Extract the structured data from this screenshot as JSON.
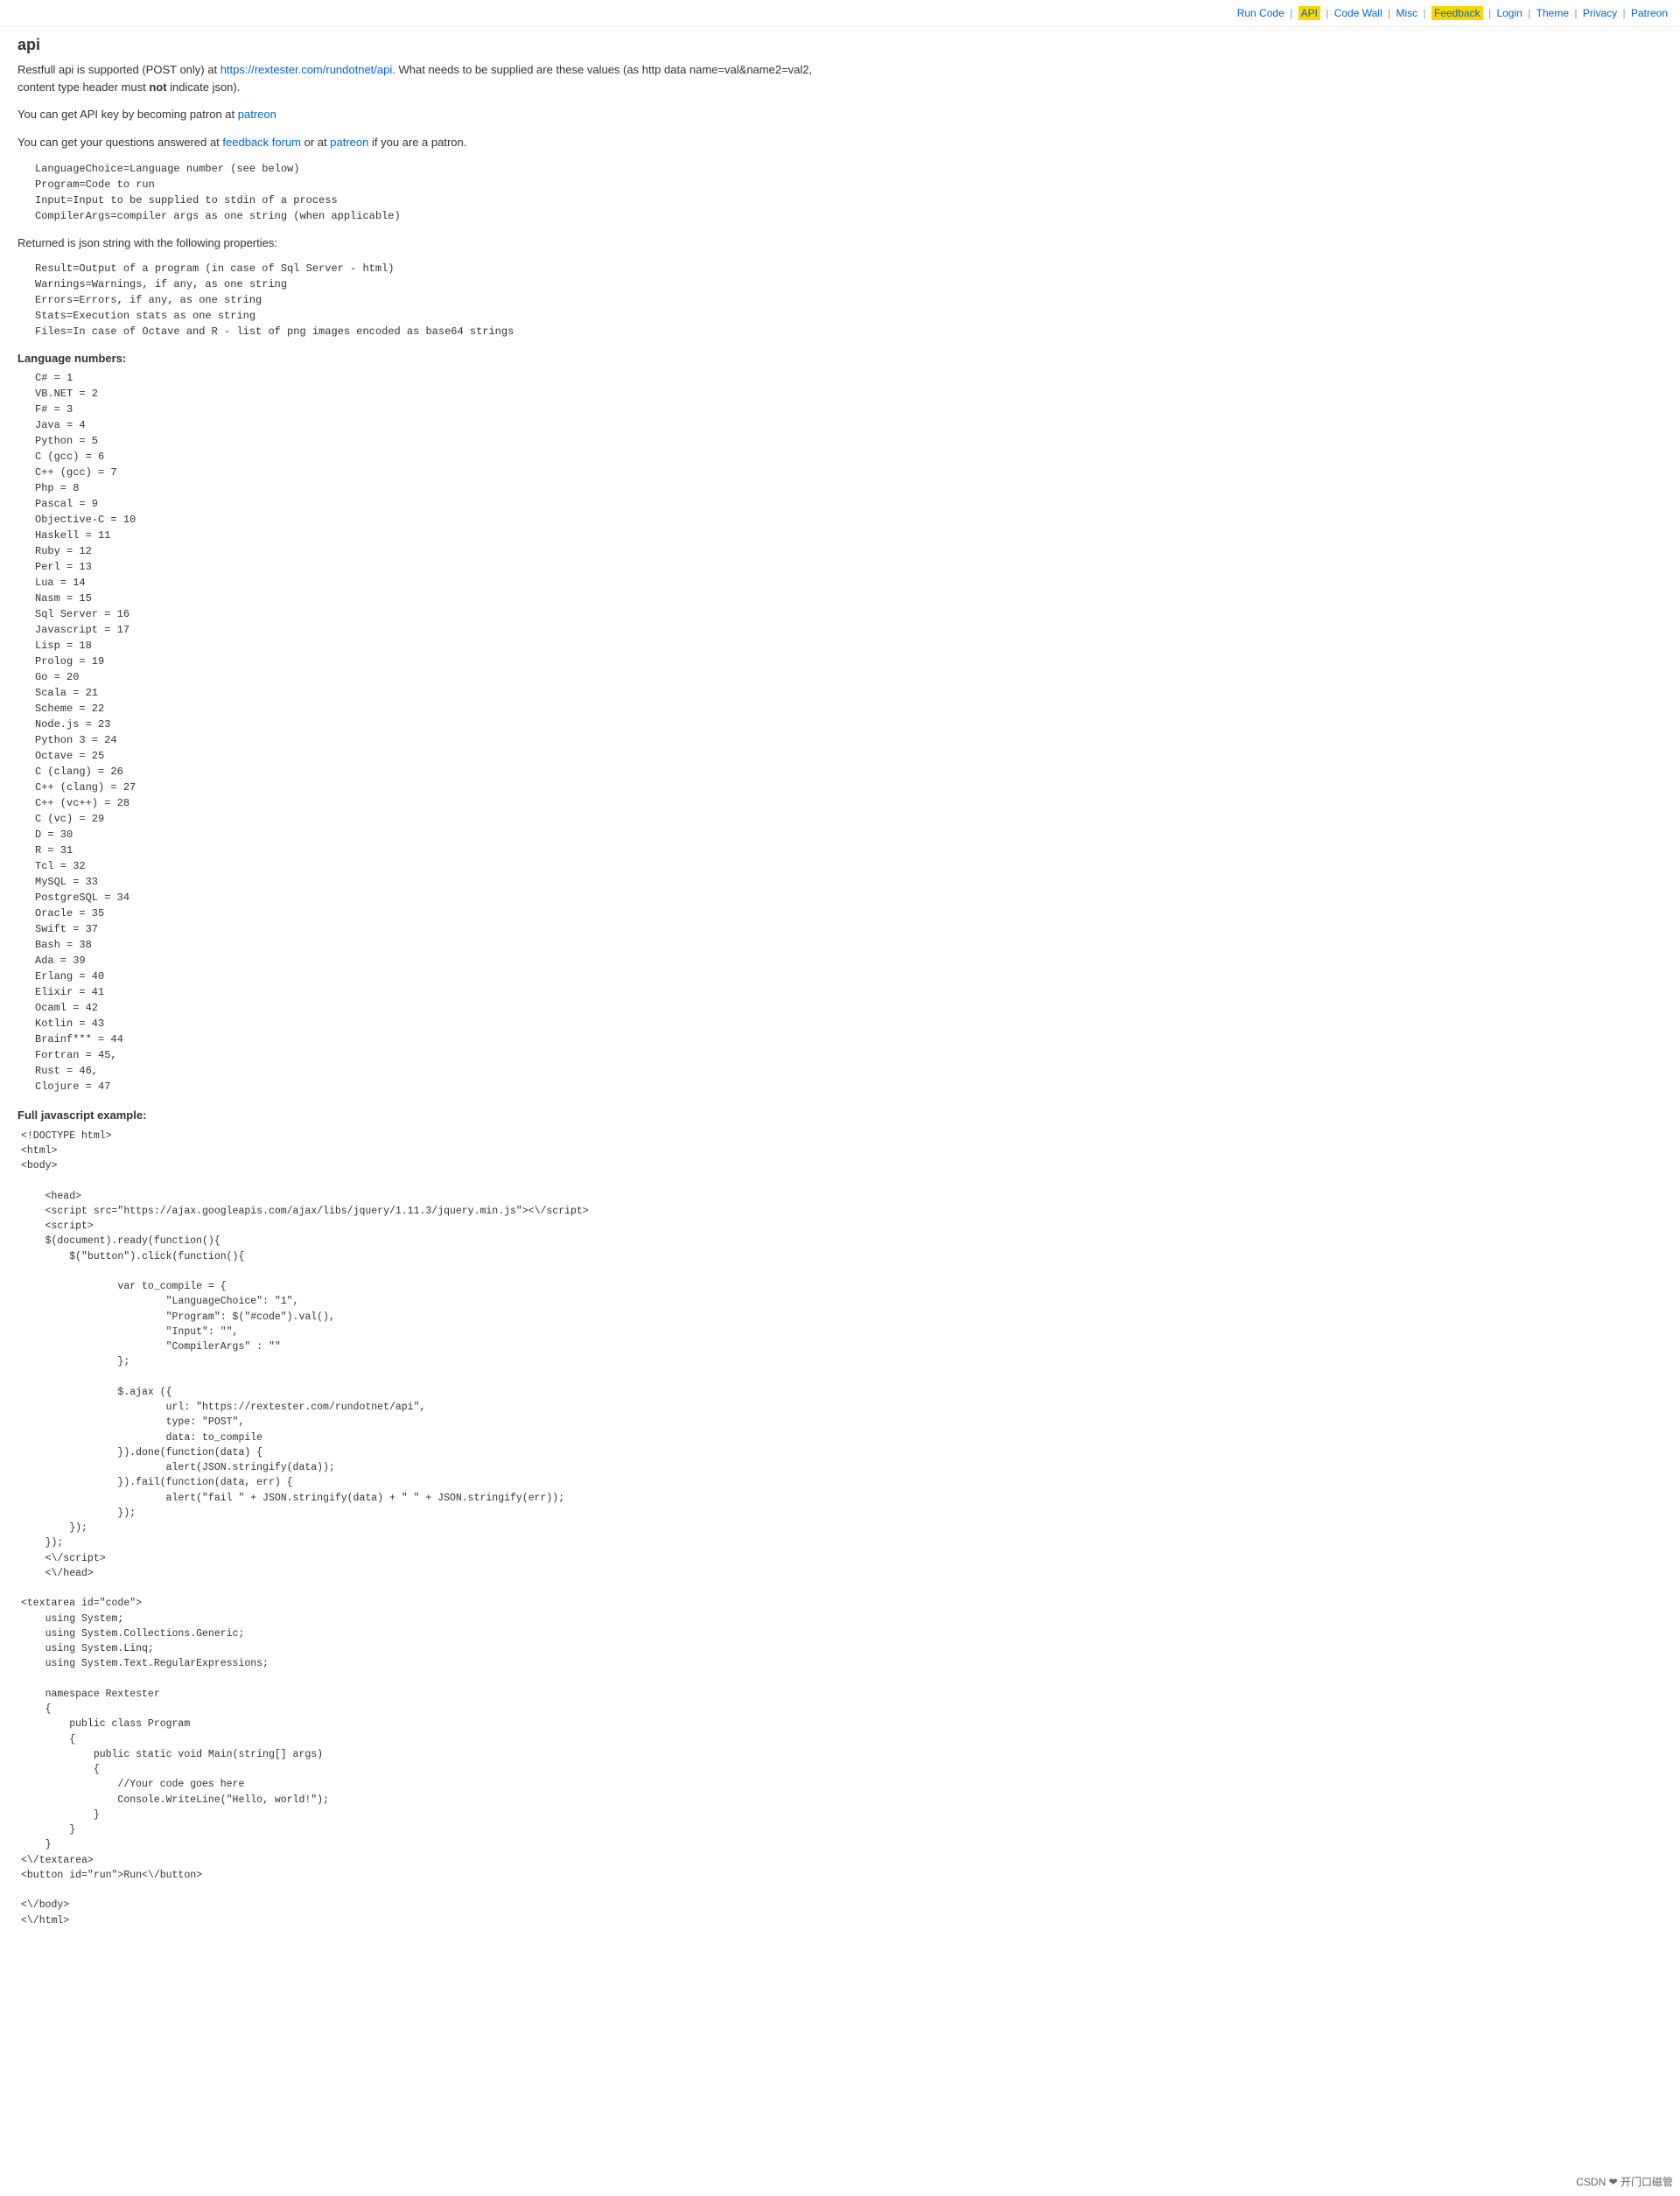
{
  "nav": {
    "items": [
      {
        "label": "Run Code",
        "url": "#",
        "id": "run-code"
      },
      {
        "label": "API",
        "url": "#",
        "id": "api",
        "highlighted": true
      },
      {
        "label": "Code Wall",
        "url": "#",
        "id": "code-wall"
      },
      {
        "label": "Misc",
        "url": "#",
        "id": "misc"
      },
      {
        "label": "Feedback",
        "url": "#",
        "id": "feedback",
        "highlighted": true
      },
      {
        "label": "Login",
        "url": "#",
        "id": "login"
      },
      {
        "label": "Theme",
        "url": "#",
        "id": "theme"
      },
      {
        "label": "Privacy",
        "url": "#",
        "id": "privacy"
      },
      {
        "label": "Patreon",
        "url": "#",
        "id": "patreon"
      }
    ]
  },
  "page": {
    "title": "api",
    "intro1": "Restfull api is supported (POST only) at https://rextester.com/rundotnet/api. What needs to be supplied are these values (as http data name=val&name2=val2, content type header must not indicate json).",
    "intro1_url": "https://rextester.com/rundotnet/api",
    "intro2_prefix": "You can get API key by becoming patron at ",
    "intro2_link": "patreon",
    "intro3_prefix": "You can get your questions answered at ",
    "intro3_link1": "feedback forum",
    "intro3_middle": " or at ",
    "intro3_link2": "patreon",
    "intro3_suffix": " if you are a patron.",
    "params_label": "",
    "params": "LanguageChoice=Language number (see below)\nProgram=Code to run\nInput=Input to be supplied to stdin of a process\nCompilerArgs=compiler args as one string (when applicable)",
    "returned_label": "Returned is json string with the following properties:",
    "returned": "Result=Output of a program (in case of Sql Server - html)\nWarnings=Warnings, if any, as one string\nErrors=Errors, if any, as one string\nStats=Execution stats as one string\nFiles=In case of Octave and R - list of png images encoded as base64 strings",
    "language_numbers_label": "Language numbers:",
    "language_numbers": "C# = 1\nVB.NET = 2\nF# = 3\nJava = 4\nPython = 5\nC (gcc) = 6\nC++ (gcc) = 7\nPhp = 8\nPascal = 9\nObjective-C = 10\nHaskell = 11\nRuby = 12\nPerl = 13\nLua = 14\nNasm = 15\nSql Server = 16\nJavascript = 17\nLisp = 18\nProlog = 19\nGo = 20\nScala = 21\nScheme = 22\nNode.js = 23\nPython 3 = 24\nOctave = 25\nC (clang) = 26\nC++ (clang) = 27\nC++ (vc++) = 28\nC (vc) = 29\nD = 30\nR = 31\nTcl = 32\nMySQL = 33\nPostgreSQL = 34\nOracle = 35\nSwift = 37\nBash = 38\nAda = 39\nErlang = 40\nElixir = 41\nOcaml = 42\nKotlin = 43\nBrainf*** = 44\nFortran = 45,\nRust = 46,\nClojure = 47",
    "js_example_label": "Full javascript example:",
    "js_example": "<!DOCTYPE html>\n<html>\n<body>\n\n    <head>\n    <script src=\"https://ajax.googleapis.com/ajax/libs/jquery/1.11.3/jquery.min.js\"><\\/script>\n    <script>\n    $(document).ready(function(){\n        $(\"button\").click(function(){\n\n                var to_compile = {\n                        \"LanguageChoice\": \"1\",\n                        \"Program\": $(\"#code\").val(),\n                        \"Input\": \"\",\n                        \"CompilerArgs\" : \"\"\n                };\n\n                $.ajax ({\n                        url: \"https://rextester.com/rundotnet/api\",\n                        type: \"POST\",\n                        data: to_compile\n                }).done(function(data) {\n                        alert(JSON.stringify(data));\n                }).fail(function(data, err) {\n                        alert(\"fail \" + JSON.stringify(data) + \" \" + JSON.stringify(err));\n                });\n        });\n    });\n    <\\/script>\n    <\\/head>\n\n<textarea id=\"code\">\n    using System;\n    using System.Collections.Generic;\n    using System.Linq;\n    using System.Text.RegularExpressions;\n\n    namespace Rextester\n    {\n        public class Program\n        {\n            public static void Main(string[] args)\n            {\n                //Your code goes here\n                Console.WriteLine(\"Hello, world!\");\n            }\n        }\n    }\n<\\/textarea>\n<button id=\"run\">Run<\\/button>\n\n<\\/body>\n<\\/html>",
    "bottom_logo": "CSDN ❤ 开门口磁管"
  }
}
